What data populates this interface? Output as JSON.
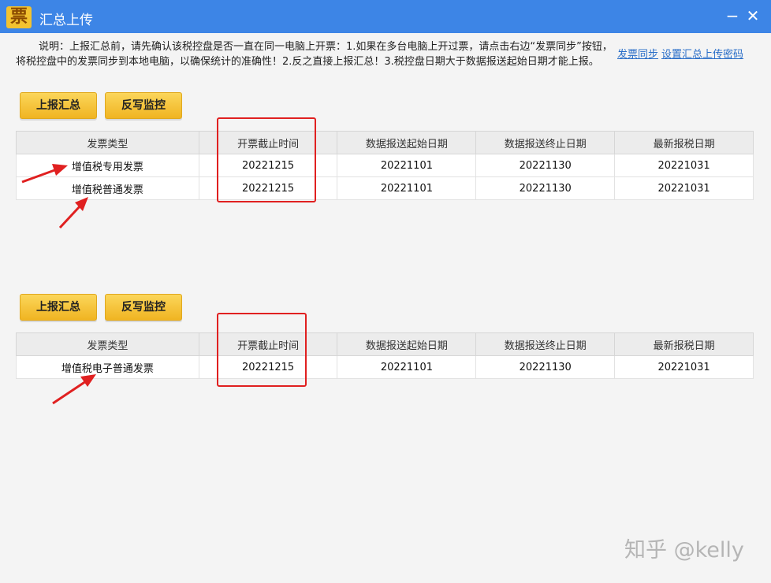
{
  "window": {
    "app_icon_glyph": "票",
    "title": "汇总上传",
    "minimize_glyph": "−",
    "close_glyph": "✕"
  },
  "description": "说明：上报汇总前，请先确认该税控盘是否一直在同一电脑上开票：1.如果在多台电脑上开过票，请点击右边“发票同步”按钮，将税控盘中的发票同步到本地电脑，以确保统计的准确性！2.反之直接上报汇总！3.税控盘日期大于数据报送起始日期才能上报。",
  "links": {
    "sync": "发票同步",
    "set_password": "设置汇总上传密码"
  },
  "section1": {
    "report_button": "上报汇总",
    "writeback_button": "反写监控",
    "headers": [
      "发票类型",
      "开票截止时间",
      "数据报送起始日期",
      "数据报送终止日期",
      "最新报税日期"
    ],
    "rows": [
      [
        "增值税专用发票",
        "20221215",
        "20221101",
        "20221130",
        "20221031"
      ],
      [
        "增值税普通发票",
        "20221215",
        "20221101",
        "20221130",
        "20221031"
      ]
    ]
  },
  "section2": {
    "report_button": "上报汇总",
    "writeback_button": "反写监控",
    "headers": [
      "发票类型",
      "开票截止时间",
      "数据报送起始日期",
      "数据报送终止日期",
      "最新报税日期"
    ],
    "rows": [
      [
        "增值税电子普通发票",
        "20221215",
        "20221101",
        "20221130",
        "20221031"
      ]
    ]
  },
  "watermark": "知乎 @kelly",
  "colors": {
    "titlebar": "#3d85e6",
    "button": "#f5c33a",
    "highlight": "#e02020",
    "link": "#2a6ec8"
  }
}
